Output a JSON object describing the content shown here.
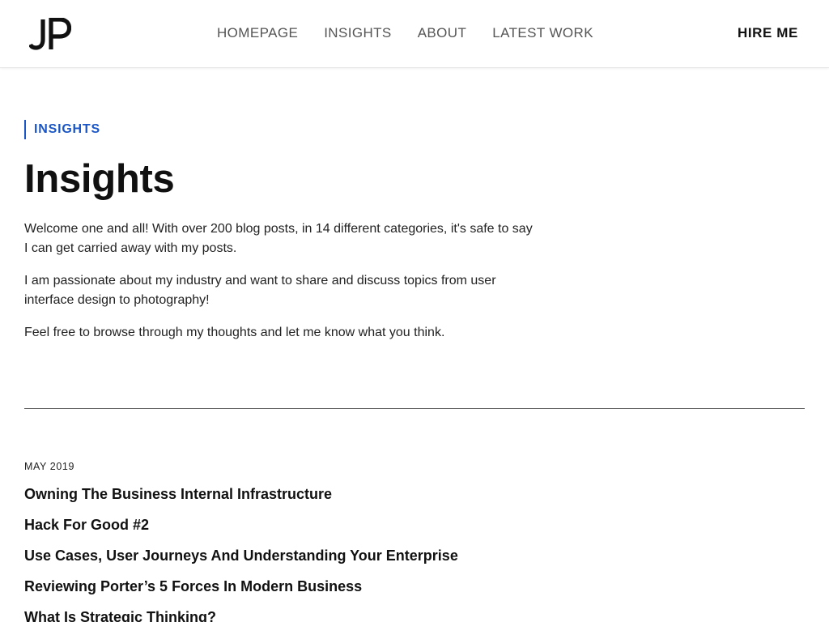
{
  "header": {
    "logo_text": "JP",
    "nav": [
      {
        "label": "HOMEPAGE"
      },
      {
        "label": "INSIGHTS"
      },
      {
        "label": "ABOUT"
      },
      {
        "label": "LATEST WORK"
      }
    ],
    "cta_label": "HIRE ME"
  },
  "hero": {
    "eyebrow": "INSIGHTS",
    "title": "Insights",
    "paragraphs": [
      "Welcome one and all! With over 200 blog posts, in 14 different categories, it's safe to say I can get carried away with my posts.",
      "I am passionate about my industry and want to share and discuss topics from user interface design to photography!",
      "Feel free to browse through my thoughts and let me know what you think."
    ]
  },
  "archive": {
    "month": "MAY 2019",
    "posts": [
      {
        "title": "Owning The Business Internal Infrastructure"
      },
      {
        "title": "Hack For Good #2"
      },
      {
        "title": "Use Cases, User Journeys And Understanding Your Enterprise"
      },
      {
        "title": "Reviewing Porter’s 5 Forces In Modern Business"
      },
      {
        "title": "What Is Strategic Thinking?"
      }
    ]
  },
  "colors": {
    "accent": "#1a56c5",
    "text": "#111111",
    "nav_text": "#555555"
  }
}
